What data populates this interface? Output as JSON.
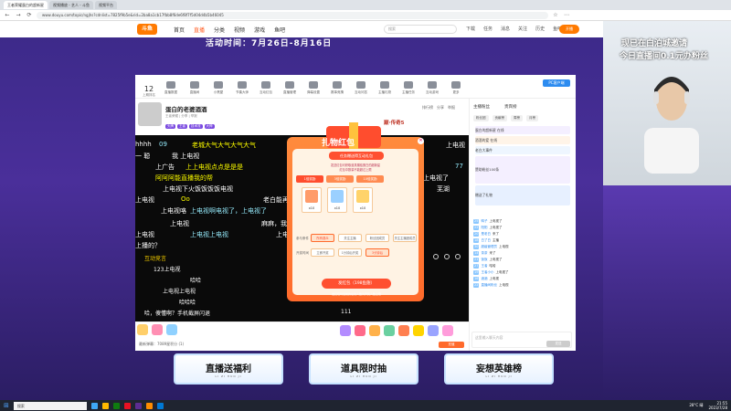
{
  "browser": {
    "tabs": [
      {
        "label": "王者荣耀蛋白的超新星",
        "active": true
      },
      {
        "label": "视频播放 - 艺人 - 斗鱼",
        "active": false
      },
      {
        "label": "视频平台",
        "active": false
      }
    ],
    "url": "www.douyu.com/topic/ngjhs?cdnlist=7825f9b5e&rid=2ba8a1cb17fbb8f6de6f8f7f5d04d4b5b46045"
  },
  "site": {
    "logo": "斗鱼",
    "nav": [
      "首页",
      "直播",
      "分类",
      "视频",
      "游戏",
      "鱼吧"
    ],
    "nav_active_index": 1,
    "search_placeholder": "搜索",
    "header_icons": [
      "下载",
      "任务",
      "消息",
      "关注",
      "历史",
      "鱼吧"
    ],
    "open_live": "开播"
  },
  "banner": {
    "text": "活动时间：7月26日-8月16日"
  },
  "webcam": {
    "line1": "现已在白泊城邀请",
    "line2": "今日直播间0.1元办粉丝"
  },
  "toolbar": {
    "fan_count": "12",
    "fan_label": "上期排名",
    "tools": [
      "直播数据",
      "直播间",
      "小黑屋",
      "节奏大师",
      "互动红包",
      "直播管理",
      "弹幕设置",
      "赛事竞猜",
      "互动问答",
      "主播礼物",
      "主播任务",
      "互动游戏",
      "更多"
    ],
    "pc_client": "PC客户端"
  },
  "streamer": {
    "name": "蛋白的老婆酒酒",
    "meta": "王者荣耀  |  分享  |  举报",
    "tags": [
      "头牌",
      "王者",
      "技术流",
      "大神"
    ],
    "rank": "巅·传奇5",
    "right": [
      "排行榜",
      "分享",
      "举报"
    ]
  },
  "danmaku": [
    "hhhh",
    "09",
    "老城大气大气大气大气",
    "上电视",
    "一 聪",
    "我 上电视",
    "上广告",
    "上上电视点点是是是",
    "77",
    "阿阿阿能直播我的帮",
    "上电视了",
    "上电视下火饭饭饭饭电视",
    "芜湖",
    "上电视",
    "Oo",
    "上电视咯",
    "老白能再上电视",
    "上电视啊电视了，上电视了",
    "上电视",
    "麻麻，我",
    "上电视",
    "上电视上电视",
    "上电视了",
    "上播的？",
    "互动竞言",
    "123上电视",
    "哈哈",
    "上电视上电视",
    "哈哈哈",
    "哈，傻懂啊？手机截屏闪退",
    "111"
  ],
  "gift_modal": {
    "title": "扎物红包",
    "banner": "任务赠送得互动礼包",
    "desc1": "发送红包可获取道具赠给蛋白的超新星",
    "desc2": "红包中数量不能超过上限",
    "tabs": [
      "1倍奖励",
      "3倍奖励",
      "10倍奖励"
    ],
    "gifts": [
      {
        "value": "x10"
      },
      {
        "value": "x10"
      },
      {
        "value": "x10"
      }
    ],
    "row1_label": "参与条件",
    "row1_options": [
      "所有观众",
      "关注主播",
      "粉丝团成员",
      "关注主播团成员"
    ],
    "row1_selected": 0,
    "row2_label": "开奖时间",
    "row2_options": [
      "立即开奖",
      "1分钟后开奖",
      "3分钟后"
    ],
    "row2_selected": 2,
    "send": "发红包（198鱼翅）",
    "footer": "发红包时当前的在线人数为开奖人数上限"
  },
  "giftbar": {
    "count_text": "最新弹幕：7089星积分 (1)"
  },
  "chat": {
    "tabs": [
      "主播粉丝",
      "贵宾榜"
    ],
    "subtabs": [
      "粉丝团",
      "贡献榜",
      "周榜",
      "月榜"
    ],
    "fans": [
      {
        "name": "蛋白的超新星 在线"
      },
      {
        "name": "酒酒的爱 在线"
      },
      {
        "name": "老白大事件"
      },
      {
        "name": "赞助粉丝100条"
      },
      {
        "name": "赠送了礼物"
      }
    ],
    "messages": [
      {
        "lv": "25",
        "name": "鸭子",
        "text": "上电视了"
      },
      {
        "lv": "22",
        "name": "阳阳",
        "text": "上电视了"
      },
      {
        "lv": "20",
        "name": "是老白",
        "text": "来了"
      },
      {
        "lv": "18",
        "name": "白了白",
        "text": "主播"
      },
      {
        "lv": "30",
        "name": "超级管理员",
        "text": "上电视"
      },
      {
        "lv": "14",
        "name": "茶茶",
        "text": "来了"
      },
      {
        "lv": "21",
        "name": "饭饭",
        "text": "上电视了"
      },
      {
        "lv": "27",
        "name": "王者",
        "text": "哈哈"
      },
      {
        "lv": "19",
        "name": "王者小小",
        "text": "上电视了"
      },
      {
        "lv": "16",
        "name": "酒酒",
        "text": "上电视"
      },
      {
        "lv": "22",
        "name": "直播间粉丝",
        "text": "上电视"
      }
    ],
    "input_placeholder": "这里输入聊天内容",
    "send": "发送"
  },
  "promos": [
    {
      "title": "直播送福利",
      "sub": "LI ZI HUO JI"
    },
    {
      "title": "道具限时抽",
      "sub": "LI ZI HUO JI"
    },
    {
      "title": "妄想英雄榜",
      "sub": "LI ZI HUO JI"
    }
  ],
  "taskbar": {
    "search": "搜索",
    "weather": "28°C  晴",
    "time": "21:55",
    "date": "2023/7/28"
  }
}
